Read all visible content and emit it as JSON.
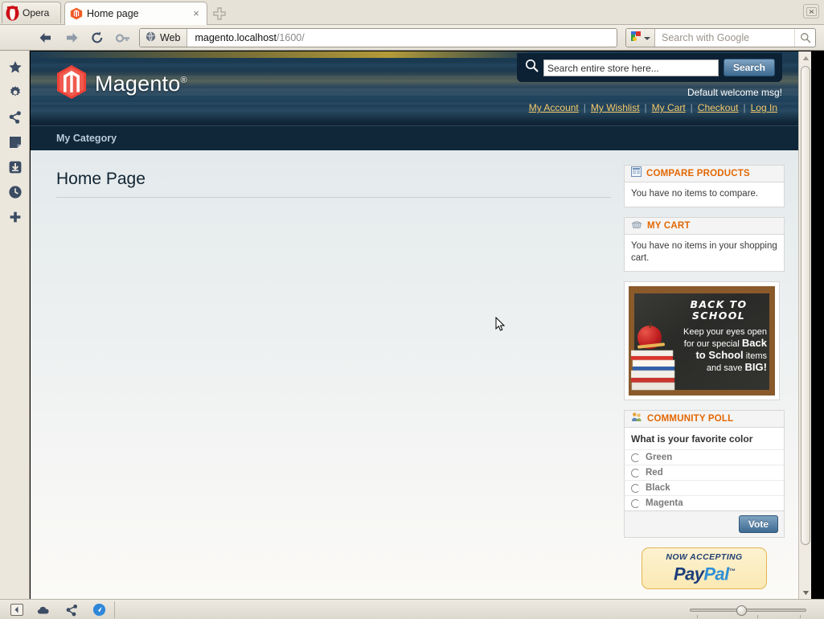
{
  "browser": {
    "name": "Opera",
    "menu_button_label": "Opera",
    "tab": {
      "title": "Home page",
      "close_label": "×",
      "favicon": "magento-favicon"
    },
    "new_tab_label": "+",
    "window_close_label": "×",
    "nav": {
      "back": "back-arrow",
      "forward": "forward-arrow",
      "reload": "reload-arrow",
      "wand": "wand-icon"
    },
    "address_bar": {
      "scope_label": "Web",
      "url_host": "magento.localhost",
      "url_path": "/1600/"
    },
    "search_bar": {
      "engine": "Google",
      "placeholder": "Search with Google",
      "value": ""
    },
    "left_panel_items": [
      {
        "name": "bookmarks",
        "icon": "star-icon"
      },
      {
        "name": "settings",
        "icon": "gear-icon"
      },
      {
        "name": "share",
        "icon": "share-icon"
      },
      {
        "name": "notes",
        "icon": "note-icon"
      },
      {
        "name": "downloads",
        "icon": "download-icon"
      },
      {
        "name": "history",
        "icon": "clock-icon"
      },
      {
        "name": "add-panel",
        "icon": "plus-icon"
      }
    ],
    "status_bar_items": [
      {
        "name": "toggle-panel",
        "icon": "panel-toggle-icon"
      },
      {
        "name": "weather",
        "icon": "cloud-icon"
      },
      {
        "name": "share",
        "icon": "share-icon"
      },
      {
        "name": "speed-dial",
        "icon": "speeddial-icon"
      }
    ],
    "zoom": {
      "value": "100%"
    }
  },
  "store": {
    "logo_text": "Magento",
    "logo_reg": "®",
    "search": {
      "placeholder": "Search entire store here...",
      "value": "",
      "button_label": "Search"
    },
    "welcome_message": "Default welcome msg!",
    "account_links": [
      {
        "label": "My Account"
      },
      {
        "label": "My Wishlist"
      },
      {
        "label": "My Cart"
      },
      {
        "label": "Checkout"
      },
      {
        "label": "Log In"
      }
    ],
    "link_separator": "|",
    "nav_items": [
      {
        "label": "My Category"
      }
    ],
    "page_title": "Home Page",
    "sidebar": {
      "compare": {
        "title": "COMPARE PRODUCTS",
        "icon": "compare-icon",
        "empty_text": "You have no items to compare."
      },
      "cart": {
        "title": "MY CART",
        "icon": "cart-icon",
        "empty_text": "You have no items in your shopping cart."
      },
      "banner": {
        "alt": "back-to-school-banner",
        "headline": "BACK TO SCHOOL",
        "line1": "Keep your eyes open",
        "line2_pre": "for our special ",
        "line2_bold": "Back",
        "line3_bold": "to School",
        "line3_post": " items",
        "line4_pre": "and save ",
        "line4_bold": "BIG!"
      },
      "poll": {
        "title": "COMMUNITY POLL",
        "icon": "poll-icon",
        "question": "What is your favorite color",
        "options": [
          {
            "label": "Green"
          },
          {
            "label": "Red"
          },
          {
            "label": "Black"
          },
          {
            "label": "Magenta"
          }
        ],
        "vote_label": "Vote"
      },
      "paypal": {
        "top_text": "NOW ACCEPTING",
        "brand_pay": "Pay",
        "brand_pal": "Pal",
        "tm": "™"
      }
    }
  },
  "colors": {
    "accent_orange": "#e26703",
    "header_dark": "#1d3c54",
    "nav_dark": "#0f2739",
    "link_gold": "#f5c96b",
    "button_blue": "#3e6b92"
  }
}
